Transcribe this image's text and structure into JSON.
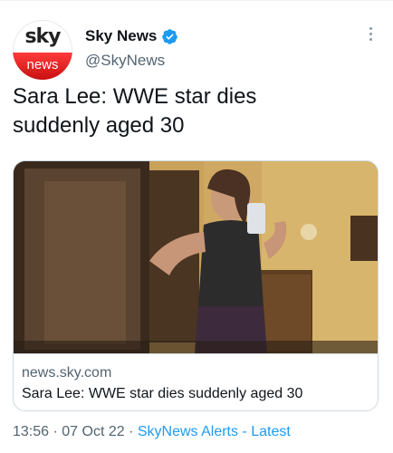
{
  "tweet": {
    "author": {
      "display_name": "Sky News",
      "handle": "@SkyNews",
      "verified": true,
      "avatar_top": "sky",
      "avatar_bottom": "news"
    },
    "text_line1": "Sara Lee: WWE star dies",
    "text_line2": "suddenly aged 30",
    "card": {
      "domain": "news.sky.com",
      "title": "Sara Lee: WWE star dies suddenly aged 30",
      "image_alt": "photo"
    },
    "meta": {
      "time": "13:56",
      "separator1": " · ",
      "date": "07 Oct 22",
      "separator2": " · ",
      "source": "SkyNews Alerts - Latest"
    }
  },
  "colors": {
    "accent": "#1d9bf0",
    "brand_red": "#d91a1a",
    "secondary_text": "#536471"
  },
  "icons": {
    "verified": "verified-badge-icon",
    "more": "more-options-icon"
  }
}
